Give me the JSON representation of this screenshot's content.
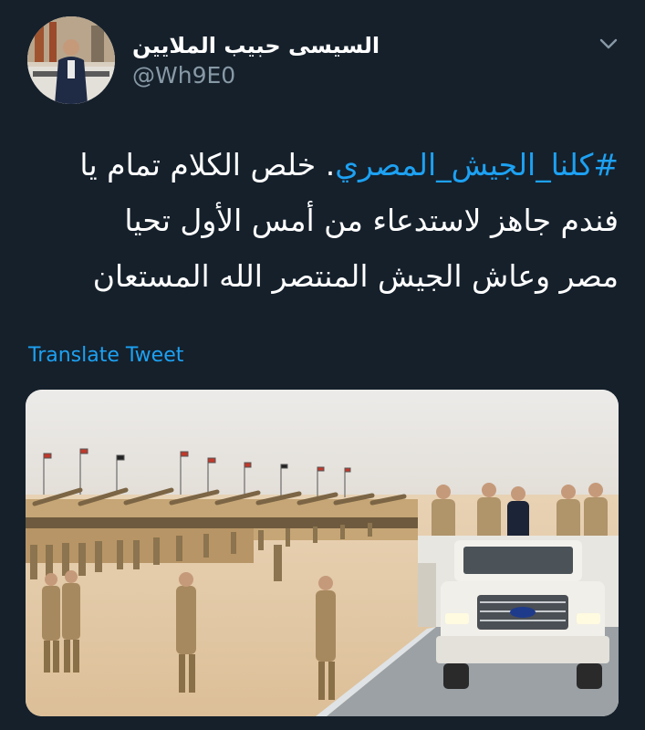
{
  "tweet": {
    "author": {
      "display_name": "السيسى حبيب الملايين",
      "handle": "@Wh9E0"
    },
    "menu_icon": "chevron-down-icon",
    "text": {
      "hashtag": "#كلنا_الجيش_المصري",
      "line1_rest": ". خلص الكلام تمام يا",
      "line2": "فندم جاهز لاستدعاء من أمس الأول تحيا",
      "line3": "مصر وعاش الجيش المنتصر الله المستعان"
    },
    "translate_label": "Translate Tweet",
    "media": {
      "description_icon": "photo",
      "colors": {
        "sky": "#ebe9e7",
        "sand": "#e5c9a6",
        "uniform": "#a88a62",
        "tank": "#c9a87a",
        "truck": "#f2f0ea",
        "road": "#9aa0a4"
      }
    }
  },
  "theme": {
    "background": "#15202b",
    "text": "#ffffff",
    "secondary": "#8899a6",
    "link": "#1da1f2"
  }
}
